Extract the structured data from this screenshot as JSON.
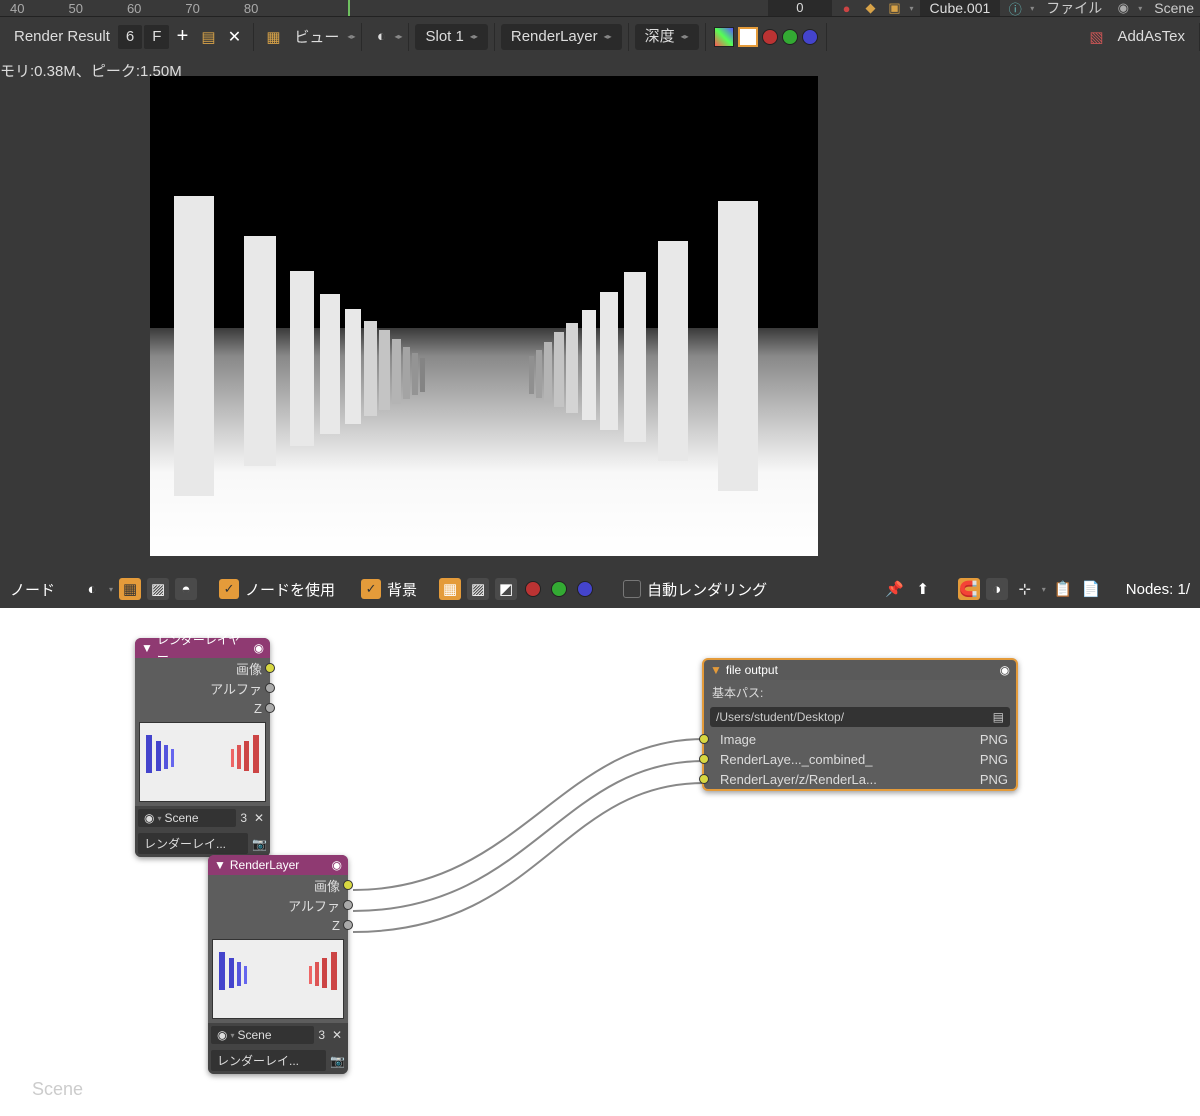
{
  "timeline": {
    "ticks": [
      "40",
      "50",
      "60",
      "70",
      "80"
    ],
    "frame": "0",
    "object": "Cube.001",
    "file_menu": "ファイル",
    "scene": "Scene"
  },
  "img_header": {
    "name": "Render Result",
    "users": "6",
    "fake": "F",
    "view_menu": "ビュー",
    "slot": "Slot 1",
    "layer": "RenderLayer",
    "pass": "深度",
    "addastex": "AddAsTex"
  },
  "mem_status": "モリ:0.38M、ピーク:1.50M",
  "node_header": {
    "node_menu": "ノード",
    "use_nodes": "ノードを使用",
    "backdrop": "背景",
    "auto_render": "自動レンダリング",
    "nodes_count": "Nodes: 1/"
  },
  "canvas": {
    "watermark": "Scene",
    "node1": {
      "title": "レンダーレイヤー",
      "out_image": "画像",
      "out_alpha": "アルファ",
      "out_z": "Z",
      "scene": "Scene",
      "scene_users": "3",
      "layer": "レンダーレイ..."
    },
    "node2": {
      "title": "RenderLayer",
      "out_image": "画像",
      "out_alpha": "アルファ",
      "out_z": "Z",
      "scene": "Scene",
      "scene_users": "3",
      "layer": "レンダーレイ..."
    },
    "node3": {
      "title": "file output",
      "base_path_label": "基本パス:",
      "base_path": "/Users/student/Desktop/",
      "rows": [
        {
          "name": "Image",
          "fmt": "PNG"
        },
        {
          "name": "RenderLaye..._combined_",
          "fmt": "PNG"
        },
        {
          "name": "RenderLayer/z/RenderLa...",
          "fmt": "PNG"
        }
      ]
    }
  }
}
